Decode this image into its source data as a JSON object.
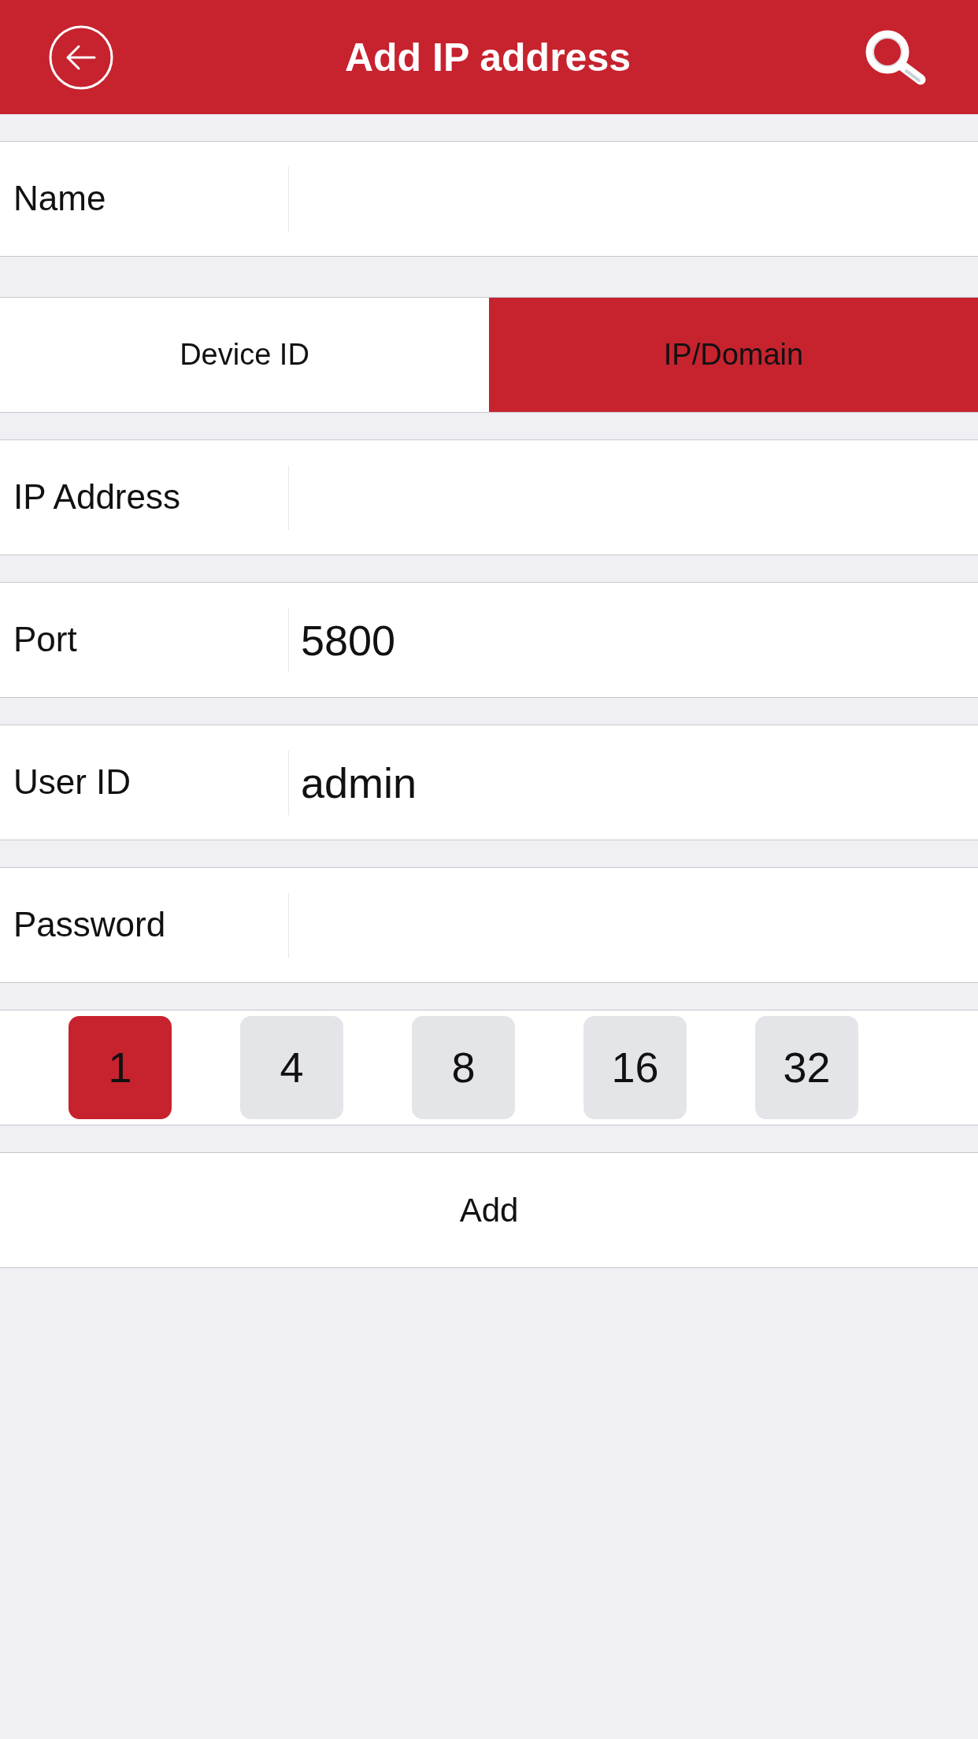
{
  "header": {
    "title": "Add IP address"
  },
  "name_field": {
    "label": "Name"
  },
  "mode_tabs": [
    {
      "label": "Device ID",
      "selected": false
    },
    {
      "label": "IP/Domain",
      "selected": true
    }
  ],
  "fields": [
    {
      "label": "IP Address"
    },
    {
      "label": "Port",
      "value": "5800"
    },
    {
      "label": "User ID",
      "value": "admin"
    },
    {
      "label": "Password"
    }
  ],
  "channels": [
    {
      "label": "1",
      "selected": true
    },
    {
      "label": "4",
      "selected": false
    },
    {
      "label": "8",
      "selected": false
    },
    {
      "label": "16",
      "selected": false
    },
    {
      "label": "32",
      "selected": false
    }
  ],
  "add_button": {
    "label": "Add"
  }
}
